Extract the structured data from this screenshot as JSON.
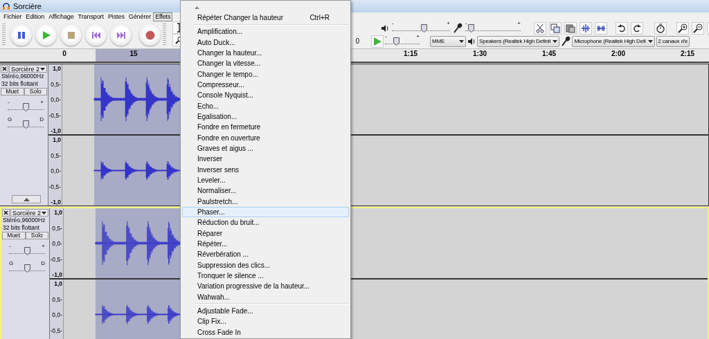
{
  "window": {
    "title": "Sorcière"
  },
  "menu_bar": [
    {
      "label": "Fichier",
      "selected": false
    },
    {
      "label": "Edition",
      "selected": false
    },
    {
      "label": "Affichage",
      "selected": false
    },
    {
      "label": "Transport",
      "selected": false
    },
    {
      "label": "Pistes",
      "selected": false
    },
    {
      "label": "Générer",
      "selected": false
    },
    {
      "label": "Effets",
      "selected": true
    }
  ],
  "meter": {
    "reading": "0"
  },
  "mixer": {
    "output_volume": {
      "min_label": "-",
      "max_label": "+",
      "level": 0.55
    },
    "input_volume": {
      "min_label": "-",
      "max_label": "+",
      "level": 0.1
    }
  },
  "play_at_speed": {
    "min_label": "-",
    "max_label": "+",
    "level": 0.32
  },
  "device": {
    "host": "MME",
    "output": "Speakers (Realtek High Definit",
    "input": "Microphone (Realtek High Defi",
    "channels": "2 canaux d'e"
  },
  "ruler": {
    "left_labels": [
      "0",
      "15"
    ],
    "right_labels": [
      "1:15",
      "1:30",
      "1:45",
      "2:00",
      "2:15"
    ]
  },
  "tracks": [
    {
      "name": "Sorcière 2",
      "info": [
        "Stéréo,96000Hz",
        "32 bits flottant"
      ],
      "buttons": [
        "Muet",
        "Solo"
      ],
      "gain": {
        "min_label": "-",
        "max_label": "+",
        "level": 0.5
      },
      "pan": {
        "min_label": "G",
        "max_label": "D",
        "level": 0.5
      },
      "focused": false,
      "collapse_button": true,
      "channels": [
        {
          "scale": [
            "1,0",
            "0,5-",
            "0,0-",
            "-0,5-",
            "-1,0"
          ]
        },
        {
          "scale": [
            "1,0",
            "0,5-",
            "0,0-",
            "-0,5-",
            "-1,0"
          ]
        }
      ]
    },
    {
      "name": "Sorcière 2",
      "info": [
        "Stéréo,96000Hz",
        "32 bits flottant"
      ],
      "buttons": [
        "Muet",
        "Solo"
      ],
      "gain": {
        "min_label": "-",
        "max_label": "+",
        "level": 0.5
      },
      "pan": {
        "min_label": "G",
        "max_label": "D",
        "level": 0.5
      },
      "focused": true,
      "channels": [
        {
          "scale": [
            "1,0",
            "0,5-",
            "0,0-",
            "-0,5-",
            "-1,0"
          ]
        },
        {
          "scale": [
            "1,0",
            "0,5-",
            "0,0-",
            "-0,5-"
          ]
        }
      ]
    }
  ],
  "effects_menu": {
    "items": [
      {
        "kind": "item",
        "label": "Répéter Changer la hauteur",
        "shortcut": "Ctrl+R",
        "selected": false
      },
      {
        "kind": "separator"
      },
      {
        "kind": "item",
        "label": "Amplification...",
        "selected": false
      },
      {
        "kind": "item",
        "label": "Auto Duck...",
        "selected": false
      },
      {
        "kind": "item",
        "label": "Changer la hauteur...",
        "selected": false
      },
      {
        "kind": "item",
        "label": "Changer la vitesse...",
        "selected": false
      },
      {
        "kind": "item",
        "label": "Changer le tempo...",
        "selected": false
      },
      {
        "kind": "item",
        "label": "Compresseur...",
        "selected": false
      },
      {
        "kind": "item",
        "label": "Console Nyquist...",
        "selected": false
      },
      {
        "kind": "item",
        "label": "Echo...",
        "selected": false
      },
      {
        "kind": "item",
        "label": "Egalisation...",
        "selected": false
      },
      {
        "kind": "item",
        "label": "Fondre en fermeture",
        "selected": false
      },
      {
        "kind": "item",
        "label": "Fondre en ouverture",
        "selected": false
      },
      {
        "kind": "item",
        "label": "Graves et aigus ...",
        "selected": false
      },
      {
        "kind": "item",
        "label": "Inverser",
        "selected": false
      },
      {
        "kind": "item",
        "label": "Inverser sens",
        "selected": false
      },
      {
        "kind": "item",
        "label": "Leveler...",
        "selected": false
      },
      {
        "kind": "item",
        "label": "Normaliser...",
        "selected": false
      },
      {
        "kind": "item",
        "label": "Paulstretch...",
        "selected": false
      },
      {
        "kind": "item",
        "label": "Phaser...",
        "selected": true
      },
      {
        "kind": "item",
        "label": "Réduction du bruit...",
        "selected": false
      },
      {
        "kind": "item",
        "label": "Réparer",
        "selected": false
      },
      {
        "kind": "item",
        "label": "Répéter...",
        "selected": false
      },
      {
        "kind": "item",
        "label": "Réverbération ...",
        "selected": false
      },
      {
        "kind": "item",
        "label": "Suppression des clics...",
        "selected": false
      },
      {
        "kind": "item",
        "label": "Tronquer le silence ...",
        "selected": false
      },
      {
        "kind": "item",
        "label": "Variation progressive de la hauteur...",
        "selected": false
      },
      {
        "kind": "item",
        "label": "Wahwah...",
        "selected": false
      },
      {
        "kind": "separator"
      },
      {
        "kind": "item",
        "label": "Adjustable Fade...",
        "selected": false
      },
      {
        "kind": "item",
        "label": "Clip Fix...",
        "selected": false
      },
      {
        "kind": "item",
        "label": "Cross Fade In",
        "selected": false
      }
    ]
  }
}
